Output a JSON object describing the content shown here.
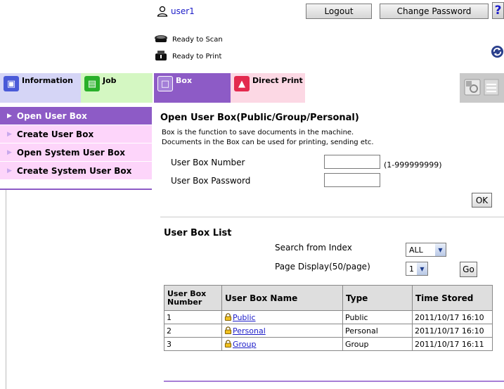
{
  "header": {
    "user_name": "user1",
    "logout_label": "Logout",
    "change_password_label": "Change Password",
    "help_label": "?"
  },
  "status": {
    "scan": "Ready to Scan",
    "print": "Ready to Print"
  },
  "tabs": [
    {
      "label": "Information"
    },
    {
      "label": "Job"
    },
    {
      "label": "Box"
    },
    {
      "label": "Direct Print"
    }
  ],
  "sidebar": {
    "items": [
      {
        "label": "Open User Box"
      },
      {
        "label": "Create User Box"
      },
      {
        "label": "Open System User Box"
      },
      {
        "label": "Create System User Box"
      }
    ]
  },
  "main": {
    "title": "Open User Box(Public/Group/Personal)",
    "desc_line1": "Box is the function to save documents in the machine.",
    "desc_line2": "Documents in the Box can be used for printing, sending etc.",
    "box_number_label": "User Box Number",
    "box_number_value": "",
    "box_number_range": "(1-999999999)",
    "box_password_label": "User Box Password",
    "box_password_value": "",
    "ok_label": "OK"
  },
  "list": {
    "title": "User Box List",
    "search_label": "Search from Index",
    "search_value": "ALL",
    "page_label": "Page Display(50/page)",
    "page_value": "1",
    "go_label": "Go",
    "columns": [
      "User Box Number",
      "User Box Name",
      "Type",
      "Time Stored"
    ],
    "rows": [
      {
        "number": "1",
        "name": "Public",
        "type": "Public",
        "time": "2011/10/17 16:10"
      },
      {
        "number": "2",
        "name": "Personal",
        "type": "Personal",
        "time": "2011/10/17 16:10"
      },
      {
        "number": "3",
        "name": "Group",
        "type": "Group",
        "time": "2011/10/17 16:11"
      }
    ]
  },
  "colors": {
    "accent_purple": "#8d5bc6",
    "sidebar_pink": "#fdd5fa",
    "link_blue": "#1c1cc8"
  }
}
